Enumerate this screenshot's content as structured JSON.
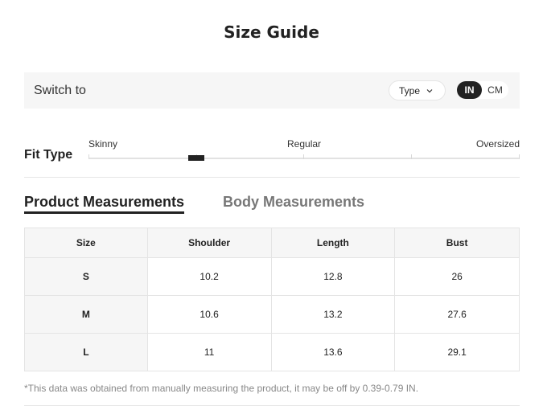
{
  "title": "Size Guide",
  "switch_bar": {
    "label": "Switch to",
    "type_select": "Type",
    "units": {
      "active": "IN",
      "inactive": "CM"
    }
  },
  "fit_type": {
    "label": "Fit Type",
    "ticks": [
      "Skinny",
      "Regular",
      "Oversized"
    ],
    "selected_position_fraction": 0.25
  },
  "tabs": {
    "active": "Product Measurements",
    "inactive": "Body Measurements"
  },
  "table": {
    "headers": [
      "Size",
      "Shoulder",
      "Length",
      "Bust"
    ],
    "rows": [
      [
        "S",
        "10.2",
        "12.8",
        "26"
      ],
      [
        "M",
        "10.6",
        "13.2",
        "27.6"
      ],
      [
        "L",
        "11",
        "13.6",
        "29.1"
      ]
    ]
  },
  "note": "*This data was obtained from manually measuring the product, it may be off by 0.39-0.79 IN.",
  "colors": {
    "accent": "#222222",
    "bar_bg": "#f6f6f6",
    "muted_text": "#777777"
  }
}
